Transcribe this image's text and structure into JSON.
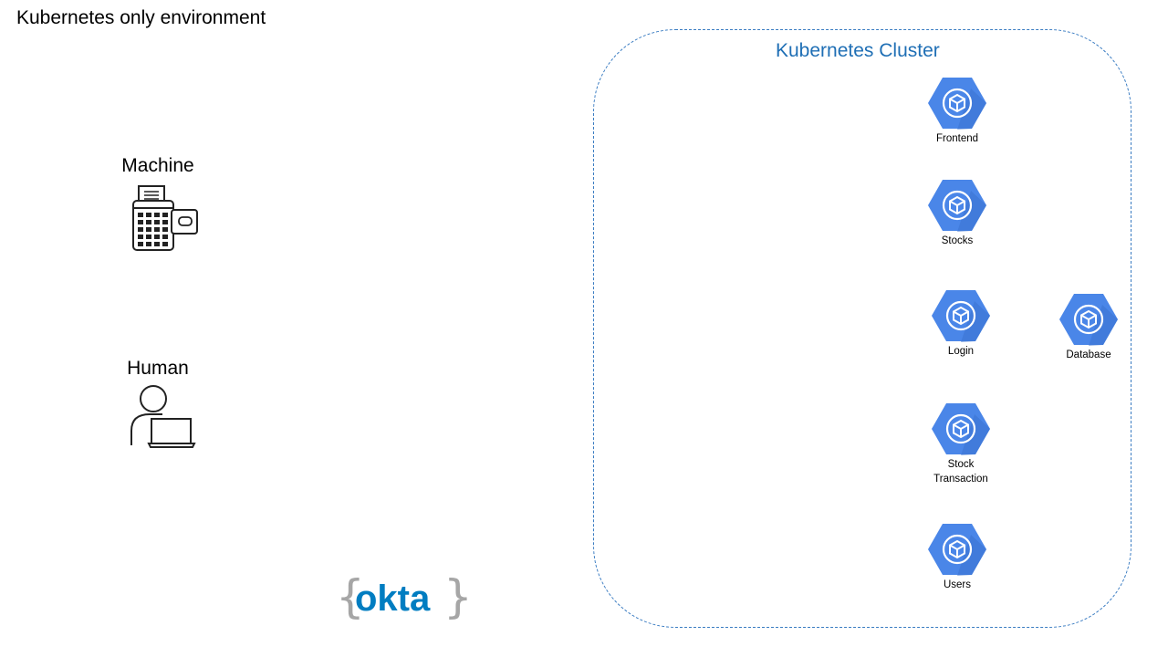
{
  "title": "Kubernetes only environment",
  "actors": {
    "machine": {
      "label": "Machine",
      "icon": "payment-terminal-icon"
    },
    "human": {
      "label": "Human",
      "icon": "person-laptop-icon"
    }
  },
  "cluster": {
    "title": "Kubernetes Cluster",
    "services": [
      {
        "name": "Frontend",
        "icon": "kubernetes-pod-icon"
      },
      {
        "name": "Stocks",
        "icon": "kubernetes-pod-icon"
      },
      {
        "name": "Login",
        "icon": "kubernetes-pod-icon"
      },
      {
        "name": "Database",
        "icon": "kubernetes-pod-icon"
      },
      {
        "name": "Stock Transaction",
        "icon": "kubernetes-pod-icon"
      },
      {
        "name": "Users",
        "icon": "kubernetes-pod-icon"
      }
    ]
  },
  "logo": {
    "text": "okta",
    "icon": "okta-logo"
  },
  "colors": {
    "accent": "#1f6fb5",
    "cluster_border": "#3a7cc2",
    "hexagon": "#4a86e8",
    "okta_blue": "#007dc1",
    "okta_braces": "#a6a6a6"
  }
}
